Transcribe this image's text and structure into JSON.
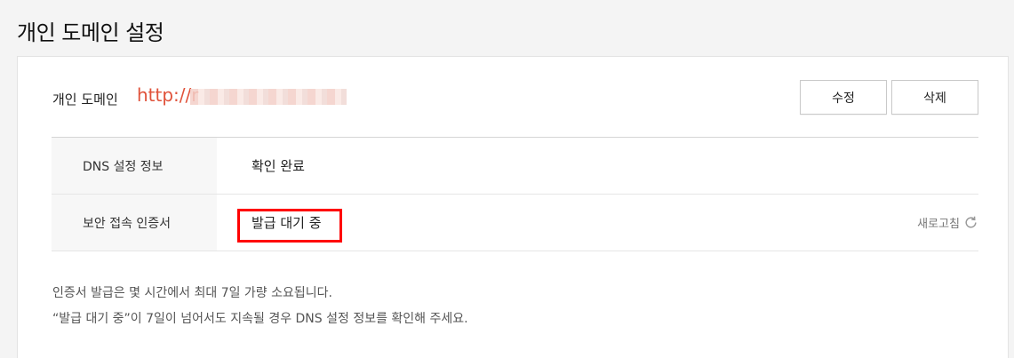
{
  "page": {
    "title": "개인 도메인 설정"
  },
  "domain": {
    "label": "개인 도메인",
    "url": "http://r"
  },
  "buttons": {
    "edit": "수정",
    "delete": "삭제"
  },
  "table": {
    "rows": [
      {
        "label": "DNS 설정 정보",
        "value": "확인 완료"
      },
      {
        "label": "보안 접속 인증서",
        "value": "발급 대기 중"
      }
    ],
    "refresh_label": "새로고침"
  },
  "notes": [
    "인증서 발급은 몇 시간에서 최대 7일 가량 소요됩니다.",
    "“발급 대기 중”이 7일이 넘어서도 지속될 경우 DNS 설정 정보를 확인해 주세요."
  ],
  "colors": {
    "accent": "#e0523a",
    "highlight_box": "#ff0000"
  },
  "icons": {
    "refresh": "refresh-icon"
  }
}
